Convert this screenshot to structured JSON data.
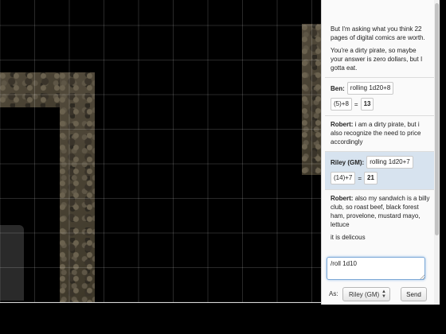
{
  "chat": {
    "messages": [
      {
        "type": "text",
        "who": "",
        "lines": [
          "But I'm asking what you think 22 pages of digital comics are worth.",
          "You're a dirty pirate, so maybe your answer is zero dollars, but I gotta eat."
        ]
      },
      {
        "type": "roll",
        "who": "Ben:",
        "formula": "rolling 1d20+8",
        "dice": "(5)+8",
        "equals": "=",
        "total": "13"
      },
      {
        "type": "text",
        "who": "Robert:",
        "text": "i am a dirty pirate, but i also recognize the need to price accordingly"
      },
      {
        "type": "roll",
        "who": "Riley (GM):",
        "formula": "rolling 1d20+7",
        "dice": "(14)+7",
        "equals": "=",
        "total": "21",
        "highlight": true
      },
      {
        "type": "text",
        "who": "Robert:",
        "text": "also my sandwich is a billy club, so roast beef, black forest ham, provelone, mustard mayo, lettuce",
        "extra": "it is delicous"
      }
    ],
    "input_value": "/roll 1d10",
    "as_label": "As:",
    "as_selected": "Riley (GM)",
    "send_label": "Send"
  },
  "colors": {
    "gm_highlight": "#d7e3ef",
    "input_focus": "#7aa7d6",
    "map_background": "#000000"
  },
  "icons": [
    "select-chevron-icon",
    "resize-grip-icon"
  ]
}
